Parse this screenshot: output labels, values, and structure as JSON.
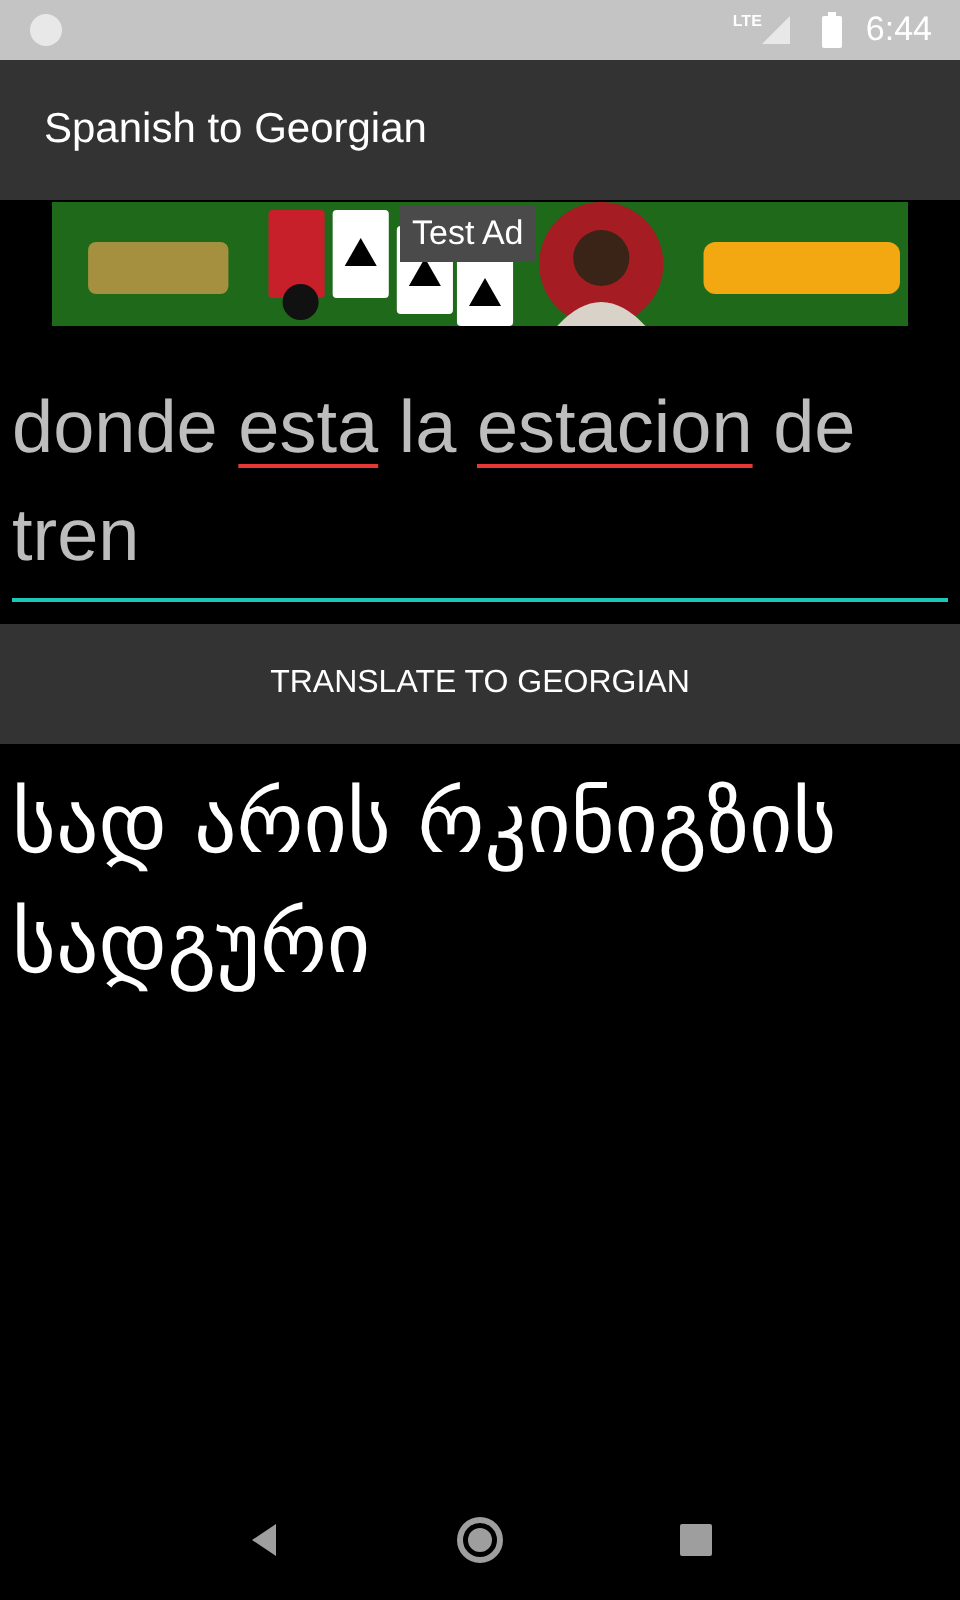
{
  "status_bar": {
    "network": "LTE",
    "time": "6:44"
  },
  "app_bar": {
    "title": "Spanish to Georgian"
  },
  "ad": {
    "kind": "picture",
    "label": "Test Ad"
  },
  "input": {
    "focused": true,
    "words": [
      {
        "text": "donde",
        "misspelled": false
      },
      {
        "text": "esta",
        "misspelled": true
      },
      {
        "text": "la",
        "misspelled": false
      },
      {
        "text": "estacion",
        "misspelled": true
      },
      {
        "text": "de",
        "misspelled": false
      },
      {
        "text": "tren",
        "misspelled": false
      }
    ]
  },
  "translate_button": {
    "label": "TRANSLATE TO GEORGIAN"
  },
  "translation": "სად არის რკინიგზის სადგური"
}
